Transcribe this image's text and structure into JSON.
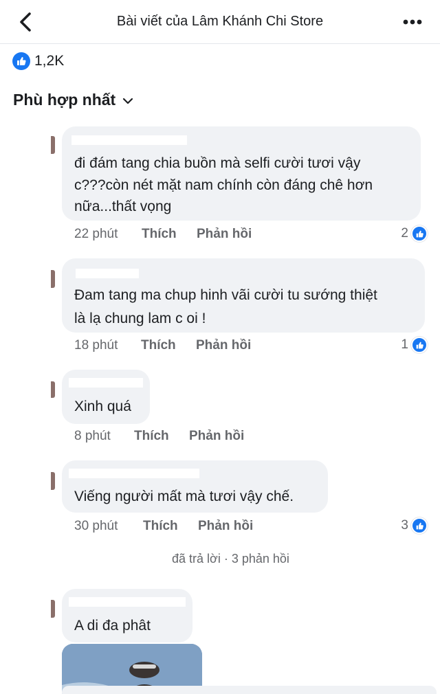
{
  "header": {
    "title": "Bài viết của Lâm Khánh Chi Store"
  },
  "reactions": {
    "count": "1,2K"
  },
  "sort": {
    "label": "Phù hợp nhất"
  },
  "comments": [
    {
      "name": "",
      "lines": [
        "đi đám tang chia buồn mà selfi cười tươi vậy",
        "c???còn nét mặt nam chính còn đáng chê hơn",
        "nữa...thất vọng"
      ],
      "time": "22 phút",
      "like": "Thích",
      "reply": "Phản hồi",
      "likes": "2"
    },
    {
      "name": "",
      "lines": [
        "Đam tang ma chup hinh vãi cười tu sướng thiệt",
        "là lạ chung lam c oi !"
      ],
      "time": "18 phút",
      "like": "Thích",
      "reply": "Phản hồi",
      "likes": "1"
    },
    {
      "name": "",
      "lines": [
        "Xinh quá"
      ],
      "time": "8 phút",
      "like": "Thích",
      "reply": "Phản hồi",
      "likes": ""
    },
    {
      "name": "",
      "lines": [
        "Viếng người mất mà tươi vậy chế."
      ],
      "time": "30 phút",
      "like": "Thích",
      "reply": "Phản hồi",
      "likes": "3"
    },
    {
      "name": "",
      "lines": [
        "A di đa phât"
      ],
      "time": "",
      "like": "",
      "reply": "",
      "likes": ""
    }
  ],
  "replies_link": "đã trả lời · 3 phản hồi",
  "icons": {
    "back": "chevron-left-icon",
    "more": "more-dots-icon",
    "like": "thumbs-up-icon",
    "sort": "chevron-down-icon"
  },
  "colors": {
    "accent": "#1877f2",
    "bubble": "#f0f2f5",
    "meta": "#65676b"
  }
}
